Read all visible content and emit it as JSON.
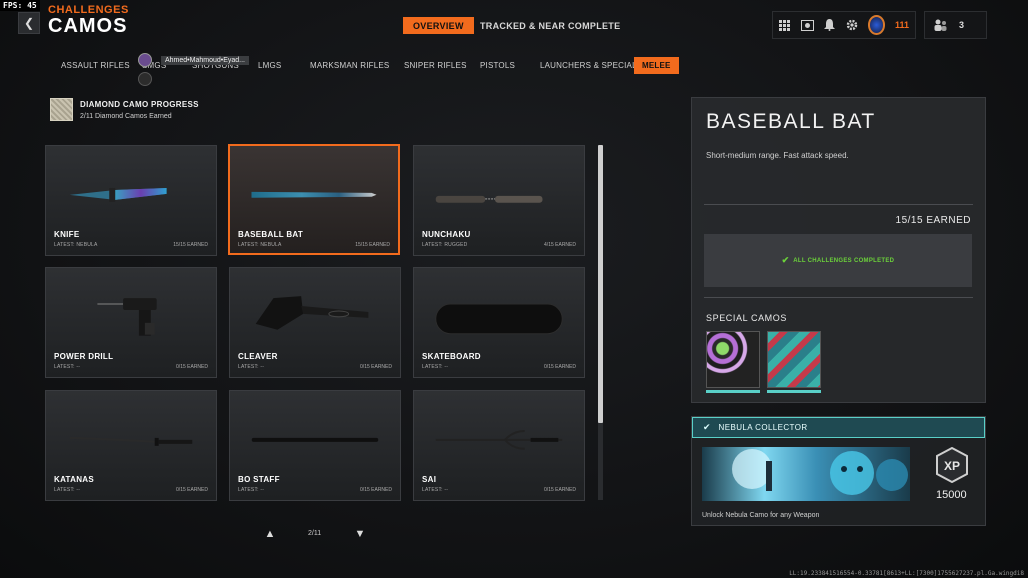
{
  "fps": {
    "label": "FPS:",
    "value": "45"
  },
  "header": {
    "breadcrumb": "CHALLENGES",
    "title": "CAMOS",
    "tabs": [
      {
        "label": "OVERVIEW",
        "active": true
      },
      {
        "label": "TRACKED & NEAR COMPLETE",
        "active": false
      }
    ]
  },
  "system_bar": {
    "icons": [
      "grid-icon",
      "store-icon",
      "bell-icon",
      "gear-icon",
      "prestige-badge-icon"
    ],
    "level": "111",
    "party_count": "3"
  },
  "categories": [
    {
      "label": "ASSAULT RIFLES",
      "active": false
    },
    {
      "label": "SMGS",
      "active": false
    },
    {
      "label": "SHOTGUNS",
      "active": false
    },
    {
      "label": "LMGS",
      "active": false
    },
    {
      "label": "MARKSMAN RIFLES",
      "active": false
    },
    {
      "label": "SNIPER RIFLES",
      "active": false
    },
    {
      "label": "PISTOLS",
      "active": false
    },
    {
      "label": "LAUNCHERS & SPECIALS",
      "active": false
    },
    {
      "label": "MELEE",
      "active": true
    }
  ],
  "overlay": {
    "player_tag": "Ahmed•Mahmoud•Eyad..."
  },
  "diamond_progress": {
    "title": "DIAMOND CAMO PROGRESS",
    "subtitle": "2/11 Diamond Camos Earned"
  },
  "weapons": [
    {
      "name": "KNIFE",
      "latest": "LATEST: NEBULA",
      "earned": "15/15 EARNED",
      "selected": false
    },
    {
      "name": "BASEBALL BAT",
      "latest": "LATEST: NEBULA",
      "earned": "15/15 EARNED",
      "selected": true
    },
    {
      "name": "NUNCHAKU",
      "latest": "LATEST: RUGGED",
      "earned": "4/15 EARNED",
      "selected": false
    },
    {
      "name": "POWER DRILL",
      "latest": "LATEST: --",
      "earned": "0/15 EARNED",
      "selected": false
    },
    {
      "name": "CLEAVER",
      "latest": "LATEST: --",
      "earned": "0/15 EARNED",
      "selected": false
    },
    {
      "name": "SKATEBOARD",
      "latest": "LATEST: --",
      "earned": "0/15 EARNED",
      "selected": false
    },
    {
      "name": "KATANAS",
      "latest": "LATEST: --",
      "earned": "0/15 EARNED",
      "selected": false
    },
    {
      "name": "BO STAFF",
      "latest": "LATEST: --",
      "earned": "0/15 EARNED",
      "selected": false
    },
    {
      "name": "SAI",
      "latest": "LATEST: --",
      "earned": "0/15 EARNED",
      "selected": false
    }
  ],
  "pager": {
    "text": "2/11"
  },
  "detail": {
    "title": "BASEBALL BAT",
    "description": "Short-medium range. Fast attack speed.",
    "earned": "15/15 EARNED",
    "status": "ALL CHALLENGES COMPLETED",
    "special_label": "SPECIAL CAMOS"
  },
  "reward": {
    "title": "NEBULA COLLECTOR",
    "xp_label": "XP",
    "xp_amount": "15000",
    "footer": "Unlock Nebula Camo for any Weapon"
  },
  "build_string": "LL:19.233841516554-0.33781[8613+LL:[7300]1755627237.pl.Ga.wingdi8",
  "colors": {
    "accent": "#f26b1d",
    "complete": "#6bd13a",
    "reward": "#5ad0c8"
  }
}
